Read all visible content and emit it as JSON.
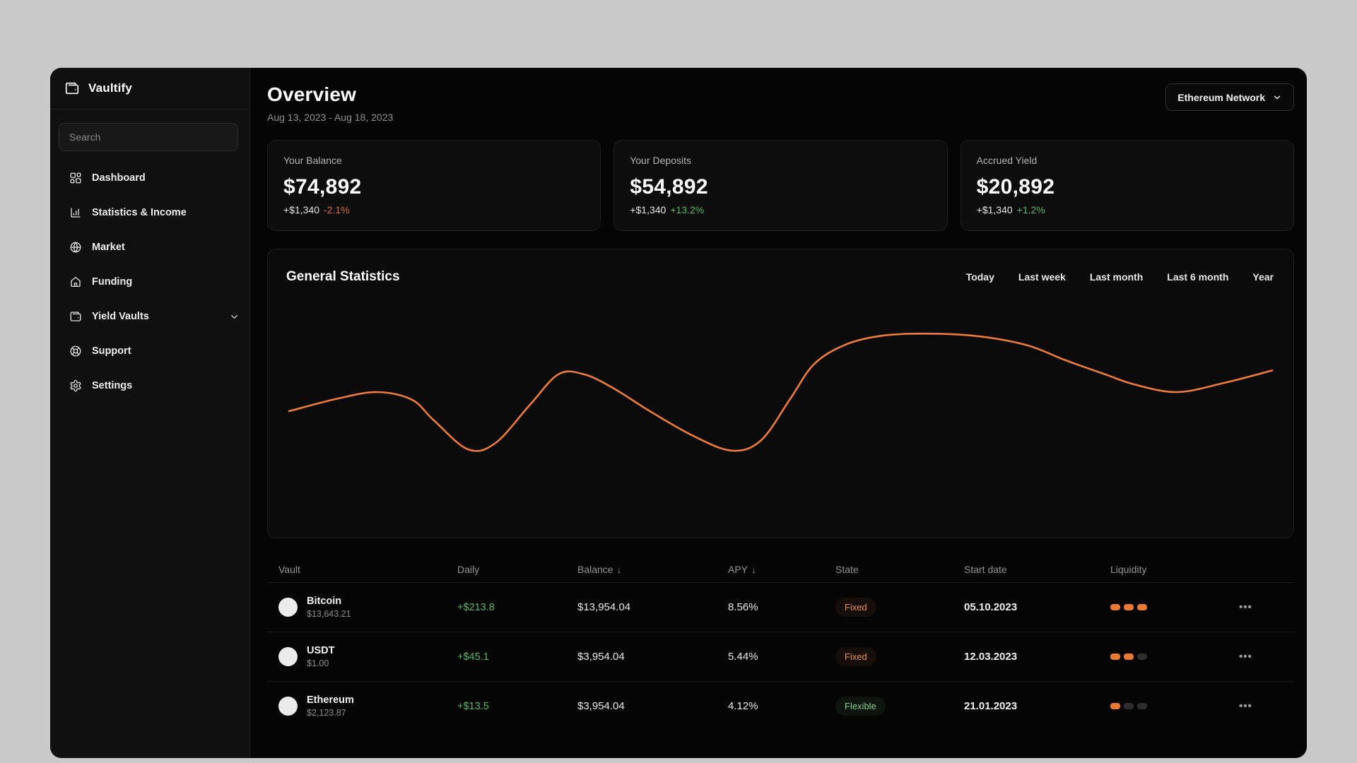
{
  "app": {
    "name": "Vaultify"
  },
  "icons": {
    "sort_desc": "↓",
    "more": "•••",
    "logo": "wallet-icon"
  },
  "sidebar": {
    "search_placeholder": "Search",
    "items": [
      {
        "label": "Dashboard",
        "icon": "dashboard-grid-icon"
      },
      {
        "label": "Statistics & Income",
        "icon": "bar-chart-icon"
      },
      {
        "label": "Market",
        "icon": "globe-icon"
      },
      {
        "label": "Funding",
        "icon": "home-icon"
      },
      {
        "label": "Yield Vaults",
        "icon": "wallet-icon",
        "has_chevron": true
      },
      {
        "label": "Support",
        "icon": "life-buoy-icon"
      },
      {
        "label": "Settings",
        "icon": "gear-icon"
      }
    ]
  },
  "header": {
    "title": "Overview",
    "date_range": "Aug 13, 2023 - Aug 18, 2023",
    "network_selector": "Ethereum Network"
  },
  "cards": [
    {
      "label": "Your Balance",
      "value": "$74,892",
      "delta": "+$1,340",
      "delta_pct": "-2.1%",
      "delta_class": "neg"
    },
    {
      "label": "Your Deposits",
      "value": "$54,892",
      "delta": "+$1,340",
      "delta_pct": "+13.2%",
      "delta_class": "pos"
    },
    {
      "label": "Accrued Yield",
      "value": "$20,892",
      "delta": "+$1,340",
      "delta_pct": "+1.2%",
      "delta_class": "pos"
    }
  ],
  "chart": {
    "title": "General Statistics",
    "tabs": [
      "Today",
      "Last week",
      "Last month",
      "Last 6 month",
      "Year"
    ]
  },
  "chart_data": {
    "type": "line",
    "title": "General Statistics",
    "line_color": "#ed7c3c",
    "axes_visible": false,
    "grid": false,
    "legend": false,
    "x_range": [
      0,
      1
    ],
    "y_note": "normalized, 0 = top of plot area, 1 = bottom (no axis labels shown in UI)",
    "points": [
      [
        0.0,
        0.65
      ],
      [
        0.05,
        0.55
      ],
      [
        0.09,
        0.5
      ],
      [
        0.125,
        0.56
      ],
      [
        0.147,
        0.72
      ],
      [
        0.182,
        0.95
      ],
      [
        0.21,
        0.9
      ],
      [
        0.245,
        0.6
      ],
      [
        0.274,
        0.36
      ],
      [
        0.3,
        0.36
      ],
      [
        0.33,
        0.47
      ],
      [
        0.367,
        0.65
      ],
      [
        0.41,
        0.84
      ],
      [
        0.45,
        0.96
      ],
      [
        0.48,
        0.88
      ],
      [
        0.51,
        0.55
      ],
      [
        0.534,
        0.28
      ],
      [
        0.565,
        0.13
      ],
      [
        0.6,
        0.06
      ],
      [
        0.644,
        0.04
      ],
      [
        0.7,
        0.06
      ],
      [
        0.75,
        0.13
      ],
      [
        0.79,
        0.25
      ],
      [
        0.83,
        0.36
      ],
      [
        0.86,
        0.44
      ],
      [
        0.903,
        0.5
      ],
      [
        0.95,
        0.43
      ],
      [
        1.0,
        0.33
      ]
    ]
  },
  "table": {
    "headers": [
      {
        "label": "Vault"
      },
      {
        "label": "Daily"
      },
      {
        "label": "Balance",
        "sorted": true
      },
      {
        "label": "APY",
        "sorted": true
      },
      {
        "label": "State"
      },
      {
        "label": "Start date"
      },
      {
        "label": "Liquidity"
      }
    ],
    "rows": [
      {
        "name": "Bitcoin",
        "price": "$13,643.21",
        "daily": "+$213.8",
        "balance": "$13,954.04",
        "apy": "8.56%",
        "state": "Fixed",
        "state_class": "badge-fixed",
        "start_date": "05.10.2023",
        "liquidity": 3
      },
      {
        "name": "USDT",
        "price": "$1.00",
        "daily": "+$45.1",
        "balance": "$3,954.04",
        "apy": "5.44%",
        "state": "Fixed",
        "state_class": "badge-fixed",
        "start_date": "12.03.2023",
        "liquidity": 2
      },
      {
        "name": "Ethereum",
        "price": "$2,123.87",
        "daily": "+$13.5",
        "balance": "$3,954.04",
        "apy": "4.12%",
        "state": "Flexible",
        "state_class": "badge-flexible",
        "start_date": "21.01.2023",
        "liquidity": 1
      }
    ]
  }
}
